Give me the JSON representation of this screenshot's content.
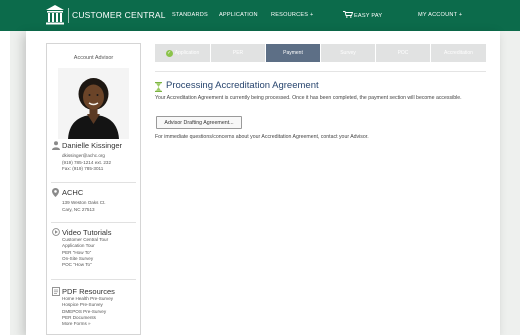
{
  "header": {
    "brand": "CUSTOMER CENTRAL",
    "nav": [
      "STANDARDS",
      "APPLICATION",
      "RESOURCES +",
      "EASY PAY",
      "MY ACCOUNT +"
    ],
    "color": "#0c6b4b"
  },
  "sidebar": {
    "title": "Account Advisor",
    "advisor": {
      "name": "Danielle Kissinger",
      "email": "dkissinger@achc.org",
      "phone": "(919) 785-1214 ext. 232",
      "fax": "Fax: (919) 785-3011"
    },
    "office": {
      "name": "ACHC",
      "street": "139 Weston Oaks Ct.",
      "city": "Cary, NC 27513"
    },
    "tutorials": {
      "heading": "Video Tutorials",
      "items": [
        "Customer Central Tour",
        "Application Tour",
        "PER \"How To\"",
        "On-Site Survey",
        "POC \"How To\""
      ]
    },
    "pdf": {
      "heading": "PDF Resources",
      "items": [
        "Home Health Pre-Survey",
        "Hospice Pre-Survey",
        "DMEPOS Pre-Survey",
        "PER Documents",
        "More Forms »"
      ]
    }
  },
  "steps": {
    "items": [
      "Application",
      "PER",
      "Payment",
      "Survey",
      "POC",
      "Accreditation"
    ],
    "active": "Payment",
    "completed": [
      "Application"
    ],
    "active_color": "#5d6f86"
  },
  "main": {
    "title": "Processing Accreditation Agreement",
    "body": "Your Accreditation Agreement is currently being processed. Once it has been completed, the payment section will become accessible.",
    "button_label": "Advisor Drafting Agreement...",
    "contact_note": "For immediate questions/concerns about your Accreditation Agreement, contact your Advisor.",
    "title_color": "#28456e"
  }
}
